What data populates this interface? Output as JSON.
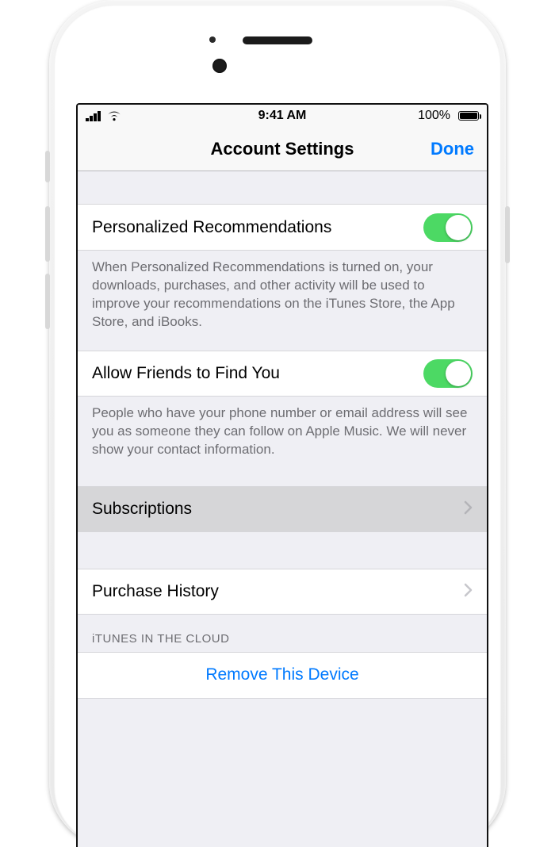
{
  "statusbar": {
    "time": "9:41 AM",
    "battery_pct": "100%"
  },
  "navbar": {
    "title": "Account Settings",
    "done": "Done"
  },
  "rows": {
    "personalized": {
      "label": "Personalized Recommendations",
      "footer": "When Personalized Recommendations is turned on, your downloads, purchases, and other activity will be used to improve your recommendations on the iTunes Store, the App Store, and iBooks.",
      "on": true
    },
    "friends": {
      "label": "Allow Friends to Find You",
      "footer": "People who have your phone number or email address will see you as someone they can follow on Apple Music. We will never show your contact information.",
      "on": true
    },
    "subscriptions": {
      "label": "Subscriptions"
    },
    "purchase_history": {
      "label": "Purchase History"
    },
    "itunes_cloud_header": "iTUNES IN THE CLOUD",
    "remove_device": {
      "label": "Remove This Device"
    }
  }
}
